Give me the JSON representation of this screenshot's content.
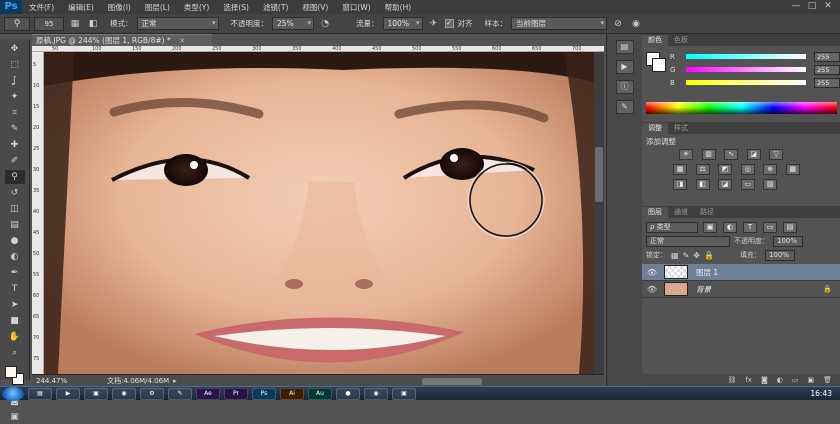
{
  "app": {
    "logo": "Ps"
  },
  "menu": [
    "文件(F)",
    "编辑(E)",
    "图像(I)",
    "图层(L)",
    "类型(Y)",
    "选择(S)",
    "滤镜(T)",
    "视图(V)",
    "窗口(W)",
    "帮助(H)"
  ],
  "window_controls": {
    "minimize": "—",
    "restore": "□",
    "close": "✕"
  },
  "options": {
    "mode_label": "模式：",
    "mode_value": "正常",
    "opacity_label": "不透明度：",
    "opacity_value": "25%",
    "flow_label": "流量：",
    "flow_value": "100%",
    "aligned_label": "对齐",
    "sample_label": "样本：",
    "sample_value": "当前图层",
    "brush_size": "95"
  },
  "document": {
    "tab_title": "原稿.JPG @ 244% (图层 1, RGB/8#) *",
    "close": "×"
  },
  "status": {
    "zoom": "244.47%",
    "doc_size": "文档:4.06M/4.06M"
  },
  "ruler_top": [
    "50",
    "100",
    "150",
    "200",
    "250",
    "300",
    "350",
    "400",
    "450",
    "500",
    "550",
    "600",
    "650",
    "700"
  ],
  "ruler_left": [
    "5",
    "10",
    "15",
    "20",
    "25",
    "30",
    "35",
    "40",
    "45",
    "50",
    "55",
    "60",
    "65",
    "70",
    "75"
  ],
  "tools": [
    "move-icon",
    "marquee-icon",
    "lasso-icon",
    "magic-wand-icon",
    "crop-icon",
    "eyedropper-icon",
    "healing-brush-icon",
    "brush-icon",
    "clone-stamp-icon",
    "history-brush-icon",
    "eraser-icon",
    "gradient-icon",
    "blur-icon",
    "dodge-icon",
    "pen-icon",
    "type-icon",
    "path-select-icon",
    "shape-icon",
    "hand-icon",
    "zoom-icon"
  ],
  "tool_glyphs": [
    "✥",
    "⬚",
    "ʆ",
    "✦",
    "⌗",
    "✎",
    "✚",
    "✐",
    "⚲",
    "↺",
    "◫",
    "▤",
    "●",
    "◐",
    "✒",
    "T",
    "➤",
    "■",
    "✋",
    "⌕"
  ],
  "color_panel": {
    "tabs": [
      "颜色",
      "色板"
    ],
    "sliders": [
      {
        "label": "R",
        "value": "255"
      },
      {
        "label": "G",
        "value": "255"
      },
      {
        "label": "B",
        "value": "255"
      }
    ]
  },
  "adjust_panel": {
    "tabs": [
      "调整",
      "样式"
    ],
    "title": "添加调整"
  },
  "layers_panel": {
    "tabs": [
      "图层",
      "通道",
      "路径"
    ],
    "filter_kind": "ρ 类型",
    "blend_mode": "正常",
    "opacity_label": "不透明度：",
    "opacity_value": "100%",
    "lock_label": "锁定：",
    "fill_label": "填充：",
    "fill_value": "100%",
    "layers": [
      {
        "name": "图层 1",
        "selected": true
      },
      {
        "name": "背景",
        "locked": true
      }
    ]
  },
  "taskbar": {
    "apps": [
      "Ae",
      "Pr",
      "Ps",
      "Ai",
      "Au"
    ],
    "clock": "16:43"
  }
}
